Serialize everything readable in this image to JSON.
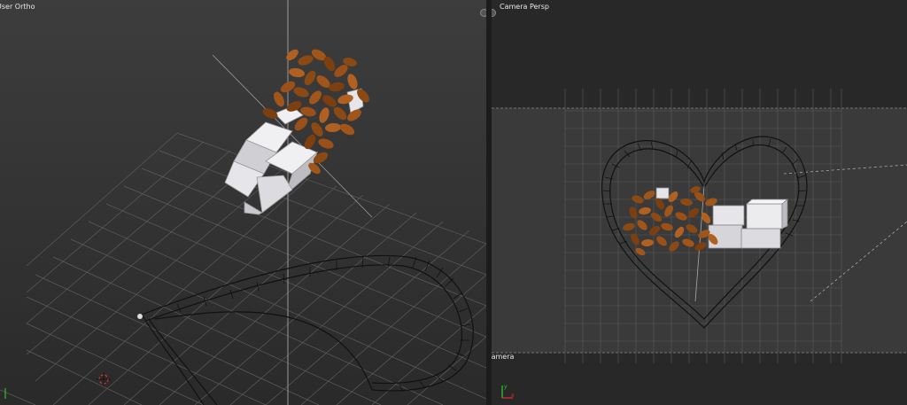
{
  "viewports": {
    "left": {
      "label": "User Ortho"
    },
    "right": {
      "label": "Camera Persp",
      "camera_label": "Camera"
    }
  },
  "colors": {
    "background": "#2b2b2b",
    "grid": "#5a5a5a",
    "bean": "#8b4a14",
    "bean_highlight": "#b86a2a",
    "cube": "#d8d8dc",
    "wire": "#111111",
    "axis_x": "#d03030",
    "axis_y": "#30c030"
  },
  "icons": [
    "view-corner-icon",
    "3d-cursor-icon",
    "axis-gizmo-icon"
  ]
}
